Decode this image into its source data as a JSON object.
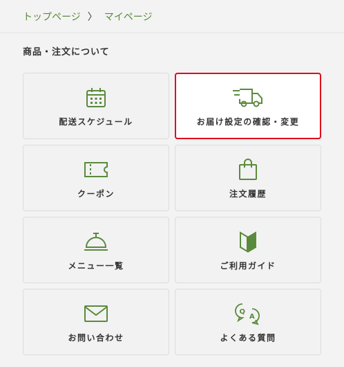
{
  "breadcrumb": {
    "home": "トップページ",
    "separator": "〉",
    "current": "マイページ"
  },
  "section": {
    "title": "商品・注文について"
  },
  "menu": {
    "items": [
      {
        "label": "配送スケジュール",
        "icon": "calendar-icon"
      },
      {
        "label": "お届け設定の確認・変更",
        "icon": "truck-icon"
      },
      {
        "label": "クーポン",
        "icon": "coupon-icon"
      },
      {
        "label": "注文履歴",
        "icon": "shopping-bag-icon"
      },
      {
        "label": "メニュー一覧",
        "icon": "service-bell-icon"
      },
      {
        "label": "ご利用ガイド",
        "icon": "guide-book-icon"
      },
      {
        "label": "お問い合わせ",
        "icon": "mail-icon"
      },
      {
        "label": "よくある質問",
        "icon": "qa-bubble-icon"
      }
    ]
  },
  "colors": {
    "accent": "#5a8a3c",
    "highlight_border": "#e0001b"
  }
}
